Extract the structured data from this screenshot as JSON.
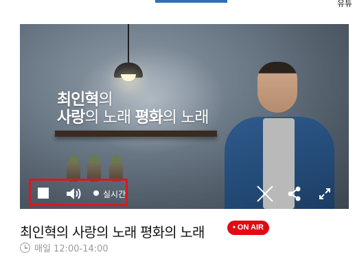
{
  "top": {
    "right_text": "유튜"
  },
  "player": {
    "art_title_line1_a": "최인혁",
    "art_title_line1_b": "의",
    "art_title_line2_a": "사랑",
    "art_title_line2_b": "의 노래 ",
    "art_title_line2_c": "평화",
    "art_title_line2_d": "의 노래",
    "live_label": "실시간"
  },
  "program": {
    "title": "최인혁의 사랑의 노래 평화의 노래",
    "badge": "• ON AIR",
    "schedule": "매일 12:00-14:00"
  },
  "colors": {
    "accent": "#2f6fb5",
    "badge": "#e10a14",
    "highlight": "#e3141b"
  }
}
